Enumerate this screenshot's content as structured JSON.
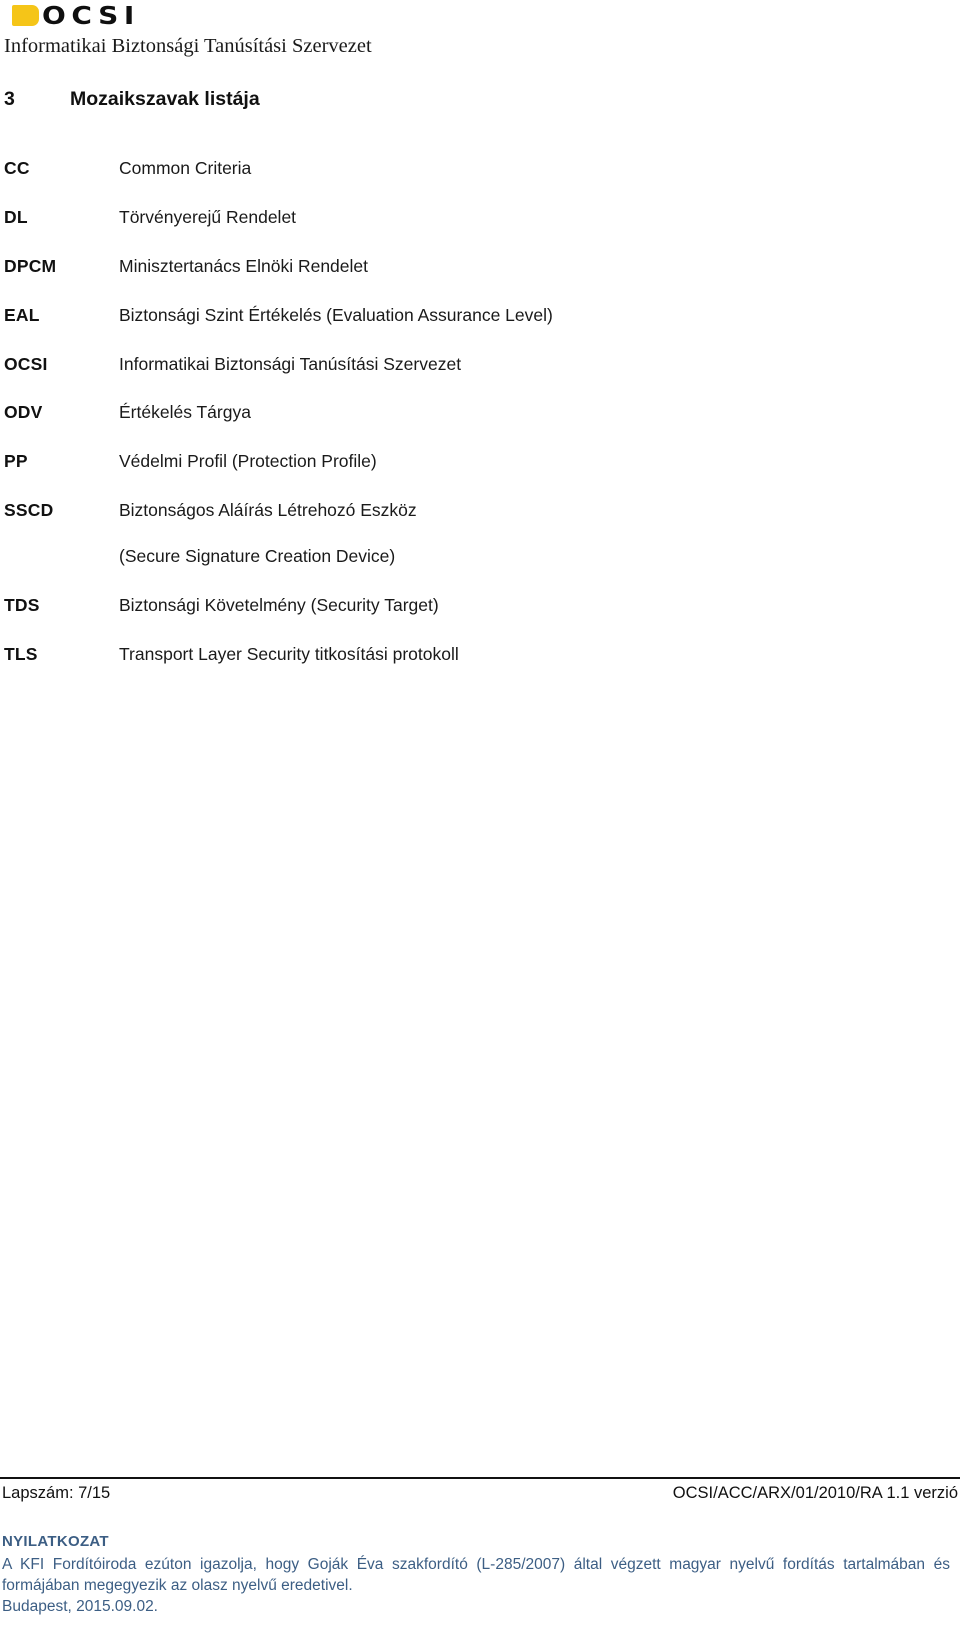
{
  "header": {
    "logo_word": "OCSI",
    "logo_icon": "ocsi-yellow-square-logo",
    "organization": "Informatikai Biztonsági Tanúsítási Szervezet",
    "accent_color": "#F5C518"
  },
  "section": {
    "number": "3",
    "title": "Mozaikszavak listája"
  },
  "glossary": {
    "entries": [
      {
        "term": "CC",
        "definition": "Common Criteria"
      },
      {
        "term": "DL",
        "definition": "Törvényerejű Rendelet"
      },
      {
        "term": "DPCM",
        "definition": "Minisztertanács Elnöki Rendelet"
      },
      {
        "term": "EAL",
        "definition": "Biztonsági Szint Értékelés (Evaluation Assurance Level)"
      },
      {
        "term": "OCSI",
        "definition": "Informatikai Biztonsági Tanúsítási Szervezet"
      },
      {
        "term": "ODV",
        "definition": "Értékelés Tárgya"
      },
      {
        "term": "PP",
        "definition": "Védelmi Profil (Protection Profile)"
      },
      {
        "term": "SSCD",
        "definition": "Biztonságos Aláírás Létrehozó Eszköz"
      },
      {
        "term": "",
        "definition": "(Secure Signature Creation Device)"
      },
      {
        "term": "TDS",
        "definition": "Biztonsági Követelmény (Security Target)"
      },
      {
        "term": "TLS",
        "definition": "Transport Layer Security titkosítási protokoll"
      }
    ]
  },
  "footer": {
    "page_label": "Lapszám: 7/15",
    "document_id": "OCSI/ACC/ARX/01/2010/RA 1.1 verzió"
  },
  "declaration": {
    "title": "NYILATKOZAT",
    "body": "A KFI Fordítóiroda ezúton igazolja, hogy Goják Éva szakfordító (L-285/2007) által végzett magyar nyelvű fordítás tartalmában és formájában megegyezik az olasz nyelvű eredetivel.",
    "date": "Budapest, 2015.09.02.",
    "text_color": "#3C5E84"
  }
}
